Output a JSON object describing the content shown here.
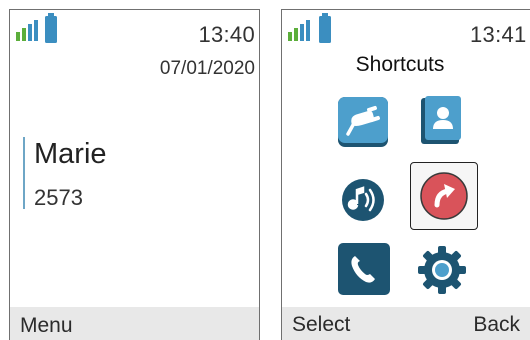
{
  "screen1": {
    "status": {
      "signal_icon": "signal-bars-icon",
      "battery_icon": "battery-icon",
      "time": "13:40"
    },
    "date": "07/01/2020",
    "contact": {
      "name": "Marie",
      "number": "2573"
    },
    "softkeys": {
      "left": "Menu"
    }
  },
  "screen2": {
    "status": {
      "signal_icon": "signal-bars-icon",
      "battery_icon": "battery-icon",
      "time": "13:41"
    },
    "title": "Shortcuts",
    "shortcuts": [
      {
        "icon": "unplug-icon",
        "selected": false
      },
      {
        "icon": "contacts-book-icon",
        "selected": false
      },
      {
        "icon": "ringtone-volume-icon",
        "selected": false
      },
      {
        "icon": "call-forward-icon",
        "selected": true
      },
      {
        "icon": "phone-handset-icon",
        "selected": false
      },
      {
        "icon": "settings-gear-icon",
        "selected": false
      }
    ],
    "softkeys": {
      "left": "Select",
      "right": "Back"
    }
  },
  "colors": {
    "accent_blue": "#3b8ec0",
    "dark_teal": "#1d5471",
    "forward_red": "#d9535a",
    "signal_green": "#5cae3b",
    "softkey_bar": "#e8e8e8"
  }
}
